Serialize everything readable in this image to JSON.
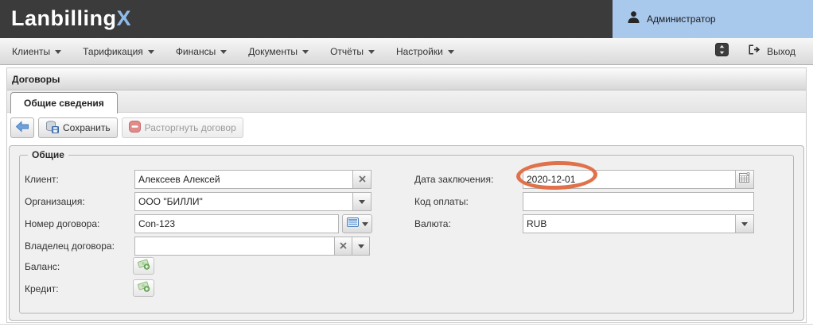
{
  "app": {
    "logo_text": "Lanbilling",
    "logo_suffix": "X"
  },
  "user": {
    "name": "Администратор"
  },
  "menu": {
    "items": [
      {
        "label": "Клиенты"
      },
      {
        "label": "Тарификация"
      },
      {
        "label": "Финансы"
      },
      {
        "label": "Документы"
      },
      {
        "label": "Отчёты"
      },
      {
        "label": "Настройки"
      }
    ],
    "exit_label": "Выход"
  },
  "page": {
    "title": "Договоры"
  },
  "tabs": {
    "general_label": "Общие сведения"
  },
  "toolbar": {
    "save_label": "Сохранить",
    "terminate_label": "Расторгнуть договор"
  },
  "form": {
    "legend": "Общие",
    "fields": {
      "client": {
        "label": "Клиент:",
        "value": "Алексеев Алексей"
      },
      "organization": {
        "label": "Организация:",
        "value": "ООО \"БИЛЛИ\""
      },
      "contract_number": {
        "label": "Номер договора:",
        "value": "Con-123"
      },
      "contract_owner": {
        "label": "Владелец договора:",
        "value": ""
      },
      "balance": {
        "label": "Баланс:"
      },
      "credit": {
        "label": "Кредит:"
      },
      "conclusion_date": {
        "label": "Дата заключения:",
        "value": "2020-12-01"
      },
      "payment_code": {
        "label": "Код оплаты:",
        "value": ""
      },
      "currency": {
        "label": "Валюта:",
        "value": "RUB"
      }
    }
  },
  "annotation": {
    "type": "highlight-ellipse",
    "color": "#e0714b",
    "target": "conclusion_date"
  },
  "icons": {
    "user": "person-icon",
    "logout": "logout-icon",
    "panel_toggle": "collapse-icon",
    "back": "back-arrow-icon",
    "save": "save-database-icon",
    "terminate": "minus-circle-icon",
    "clear": "x-icon",
    "dropdown": "chevron-down-icon",
    "contract_list": "list-icon",
    "calendar": "calendar-icon",
    "money": "money-add-icon"
  },
  "colors": {
    "header_bg": "#3b3b3b",
    "logo_accent": "#8fbbe8",
    "user_panel_bg": "#a8c8ec",
    "panel_bg": "#f0f0f1",
    "highlight": "#e0714b"
  }
}
